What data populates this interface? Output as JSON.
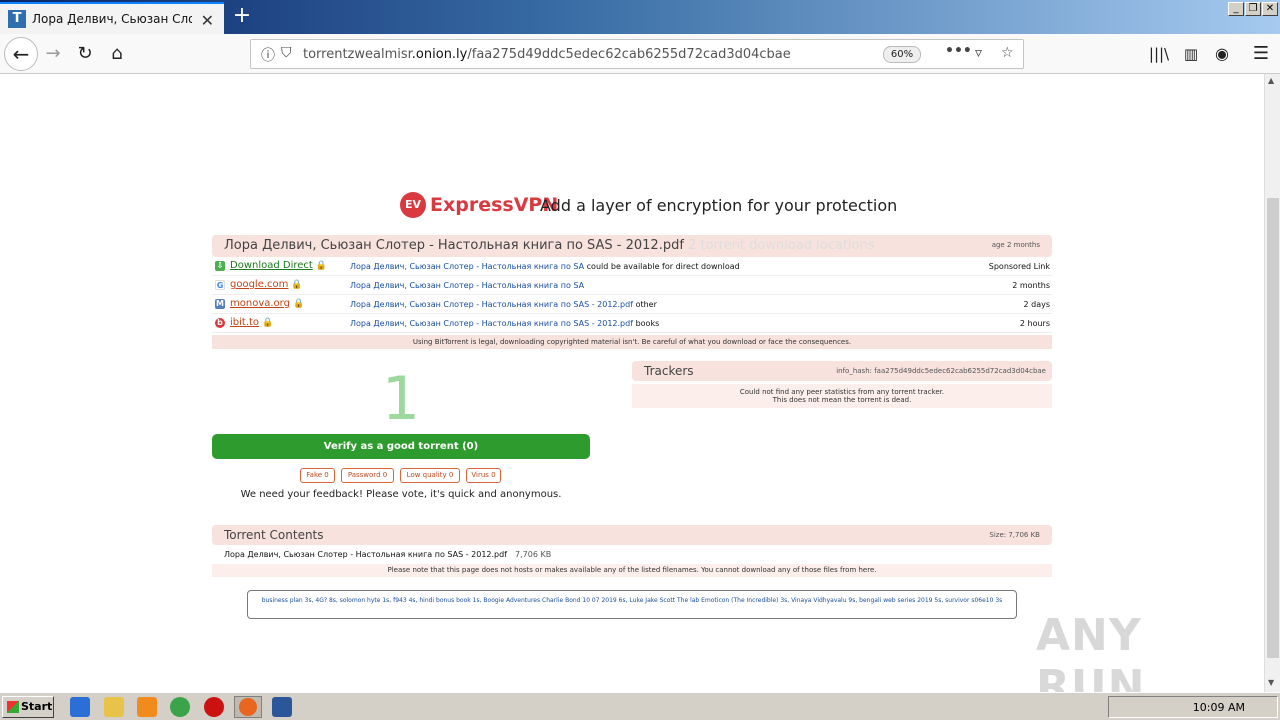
{
  "browser": {
    "tab_title": "Лора Делвич, Сьюзан Слотер - Н",
    "url_host": "torrentzwealmisr",
    "url_domain": ".onion.ly",
    "url_path": "/faa275d49ddc5edec62cab6255d72cad3d04cbae",
    "zoom": "60%",
    "new_tab": "+",
    "window_buttons": [
      "_",
      "❐",
      "✕"
    ]
  },
  "ad": {
    "logo_text": "EV",
    "brand": "ExpressVPN",
    "tagline": "Add a layer of encryption for your protection"
  },
  "torrent": {
    "title": "Лора Делвич, Сьюзан Слотер - Настольная книга по SAS - 2012.pdf",
    "locations": "2 torrent download locations",
    "age": "age 2 months",
    "sources": [
      {
        "icon": "download-icon",
        "color": "#4caf50",
        "glyph": "⇩",
        "site": "Download Direct",
        "site_color": "#1e7a1e",
        "link": "Лора Делвич, Сьюзан Слотер - Настольная книга по SA",
        "extra": "could be available for direct download",
        "when": "Sponsored Link"
      },
      {
        "icon": "google-icon",
        "color": "#ffffff",
        "glyph": "G",
        "site": "google.com",
        "site_color": "#c0461a",
        "link": "Лора Делвич, Сьюзан Слотер - Настольная книга по SA",
        "extra": "",
        "when": "2 months"
      },
      {
        "icon": "monova-icon",
        "color": "#5a7fbf",
        "glyph": "M",
        "site": "monova.org",
        "site_color": "#c0461a",
        "link": "Лора Делвич, Сьюзан Слотер - Настольная книга по SAS - 2012.pdf",
        "extra": "other",
        "when": "2 days"
      },
      {
        "icon": "ibit-icon",
        "color": "#d9363e",
        "glyph": "b",
        "site": "ibit.to",
        "site_color": "#c0461a",
        "link": "Лора Делвич, Сьюзан Слотер - Настольная книга по SAS - 2012.pdf",
        "extra": "books",
        "when": "2 hours"
      }
    ],
    "legal": "Using BitTorrent is legal, downloading copyrighted material isn't. Be careful of what you download or face the consequences."
  },
  "votes": {
    "count": "1",
    "verify_label": "Verify as a good torrent (0)",
    "buttons": [
      "Fake 0",
      "Password 0",
      "Low quality 0",
      "Virus 0"
    ],
    "feedback": "We need your feedback! Please vote, it's quick and anonymous."
  },
  "trackers": {
    "title": "Trackers",
    "info_hash": "info_hash: faa275d49ddc5edec62cab6255d72cad3d04cbae",
    "msg1": "Could not find any peer statistics from any torrent tracker.",
    "msg2": "This does not mean the torrent is dead."
  },
  "contents": {
    "title": "Torrent Contents",
    "size": "Size: 7,706 KB",
    "file_name": "Лора Делвич, Сьюзан Слотер - Настольная книга по SAS - 2012.pdf",
    "file_size": "7,706 KB",
    "notice": "Please note that this page does not hosts or makes available any of the listed filenames. You cannot download any of those files from here."
  },
  "recent": "business plan 3s, 4G? 8s, solomon hyte 1s, f943 4s, hindi bonus book 1s, Boogie Adventures Charlie Bond 10 07 2019 6s, Luke Jake Scott The lab Emoticon (The Incredible) 3s, Vinaya Vidhyavalu 9s, bengali web series 2019 5s, survivor s06e10 3s",
  "watermark": "ANY RUN",
  "taskbar": {
    "start": "Start",
    "clock": "10:09 AM"
  }
}
